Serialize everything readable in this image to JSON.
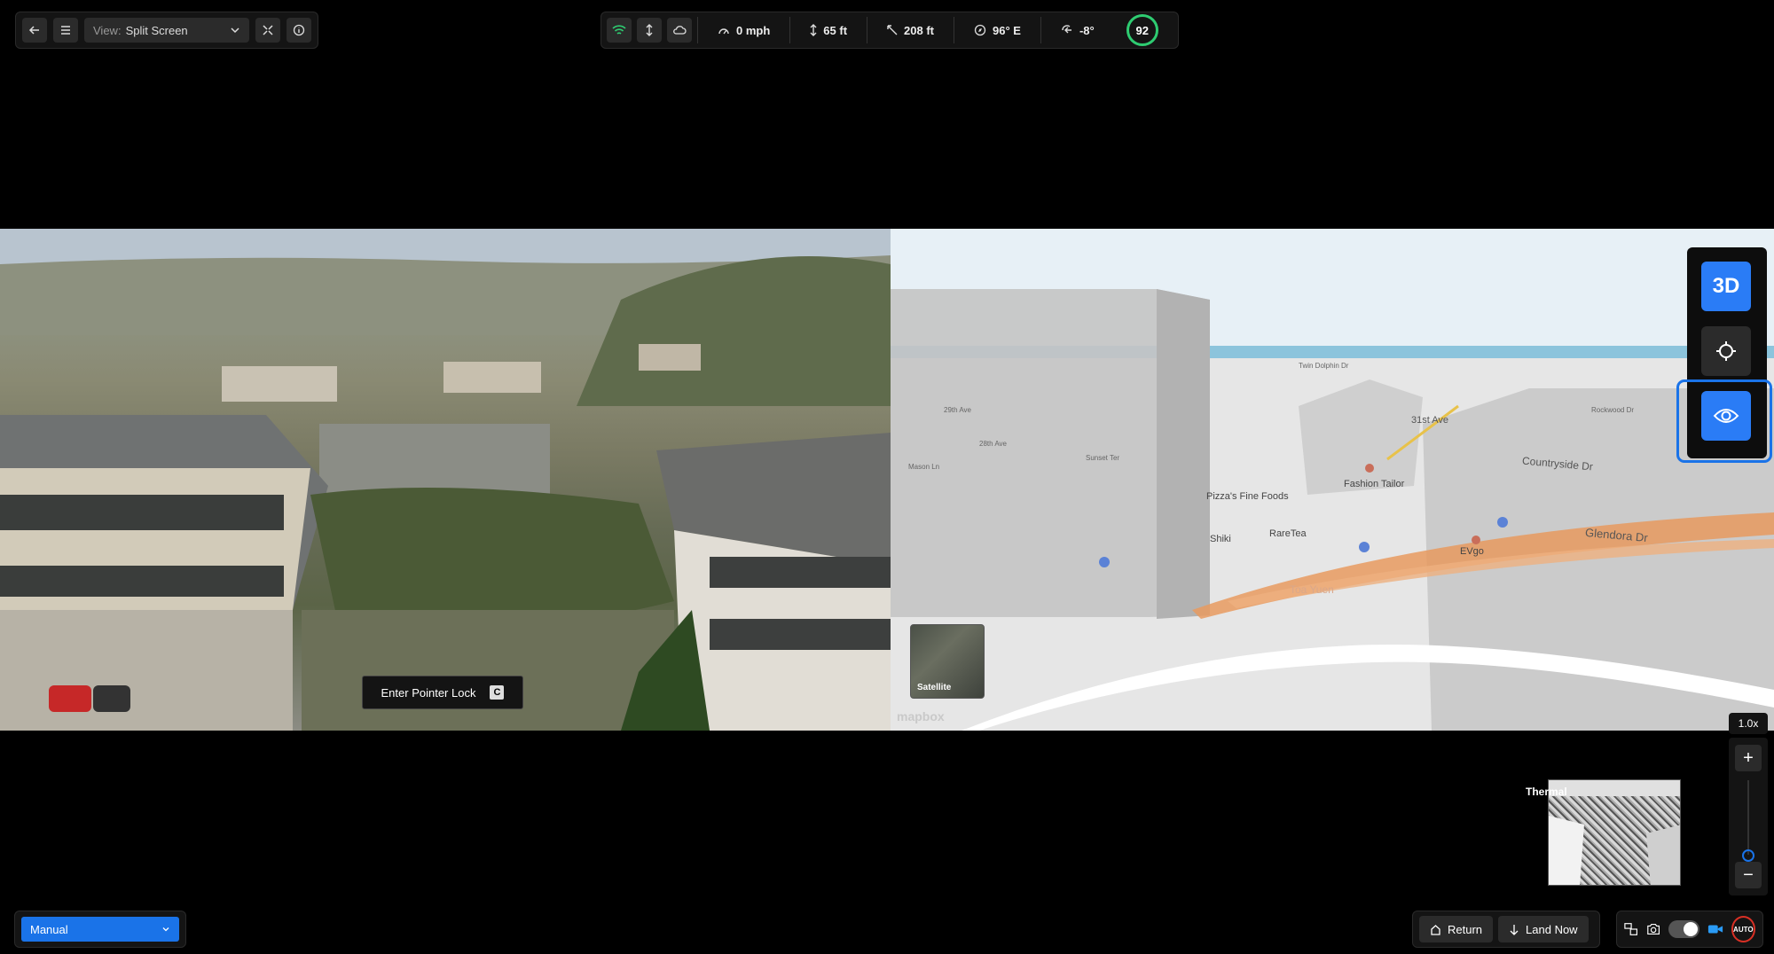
{
  "topbar": {
    "view_label": "View:",
    "view_value": "Split Screen"
  },
  "telemetry": {
    "speed": "0 mph",
    "altitude": "65 ft",
    "distance": "208 ft",
    "heading": "96° E",
    "pitch": "-8°",
    "battery": "92"
  },
  "camera": {
    "pointer_lock_label": "Enter Pointer Lock",
    "pointer_lock_key": "C"
  },
  "map": {
    "mode_3d_label": "3D",
    "satellite_label": "Satellite",
    "attribution": "mapbox",
    "labels": [
      "Pizza's Fine Foods",
      "Shiki",
      "RareTea",
      "Fashion Tailor",
      "EVgo",
      "Countryside Dr",
      "Glendora Dr",
      "31st Ave",
      "Twin Dolphin Dr",
      "28th Ave",
      "29th Ave",
      "Mason Ln",
      "Sunset Ter",
      "Rockwood Dr",
      "Toa Yuen"
    ]
  },
  "zoom": {
    "level": "1.0x",
    "plus": "+",
    "minus": "−"
  },
  "thermal": {
    "label": "Thermal"
  },
  "bottom": {
    "mode": "Manual",
    "return_label": "Return",
    "land_label": "Land Now",
    "auto_label": "AUTO"
  },
  "colors": {
    "accent": "#2a7cf6",
    "battery": "#2ecc71",
    "record": "#d93025"
  }
}
